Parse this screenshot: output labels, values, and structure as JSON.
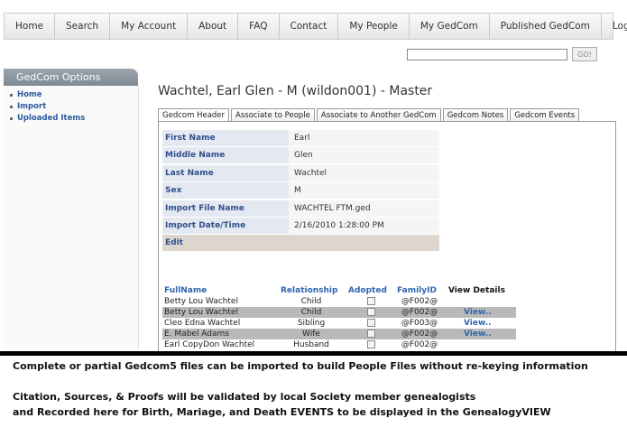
{
  "nav": [
    "Home",
    "Search",
    "My Account",
    "About",
    "FAQ",
    "Contact",
    "My People",
    "My GedCom",
    "Published GedCom",
    "Logout"
  ],
  "search": {
    "value": "",
    "button": "GO!"
  },
  "sidebar": {
    "title": "GedCom Options",
    "items": [
      "Home",
      "Import",
      "Uploaded Items"
    ]
  },
  "page_title": "Wachtel, Earl Glen - M (wildon001) - Master",
  "tabs": [
    "Gedcom Header",
    "Associate to People",
    "Associate to Another GedCom",
    "Gedcom Notes",
    "Gedcom Events"
  ],
  "details": [
    {
      "label": "First Name",
      "value": "Earl"
    },
    {
      "label": "Middle Name",
      "value": "Glen"
    },
    {
      "label": "Last Name",
      "value": "Wachtel"
    },
    {
      "label": "Sex",
      "value": "M"
    },
    {
      "label": "Import File Name",
      "value": "WACHTEL FTM.ged"
    },
    {
      "label": "Import Date/Time",
      "value": "2/16/2010 1:28:00 PM"
    }
  ],
  "edit_label": "Edit",
  "family": {
    "headers": {
      "fullname": "FullName",
      "relationship": "Relationship",
      "adopted": "Adopted",
      "familyid": "FamilyID",
      "view": "View Details"
    },
    "rows": [
      {
        "name": "Betty Lou Wachtel",
        "rel": "Child",
        "fid": "@F002@",
        "view": ""
      },
      {
        "name": "Betty Lou Wachtel",
        "rel": "Child",
        "fid": "@F002@",
        "view": "View.."
      },
      {
        "name": "Cleo Edna Wachtel",
        "rel": "Sibling",
        "fid": "@F003@",
        "view": "View.."
      },
      {
        "name": "E. Mabel Adams",
        "rel": "Wife",
        "fid": "@F002@",
        "view": "View.."
      },
      {
        "name": "Earl CopyDon Wachtel",
        "rel": "Husband",
        "fid": "@F002@",
        "view": ""
      }
    ]
  },
  "caption": {
    "line1": "Complete or partial Gedcom5 files can be imported to build People Files without re-keying information",
    "line2": "Citation, Sources,  & Proofs will be validated by local Society member genealogists",
    "line3": "and Recorded here for Birth, Mariage, and Death EVENTS to be displayed in the GenealogyVIEW"
  }
}
